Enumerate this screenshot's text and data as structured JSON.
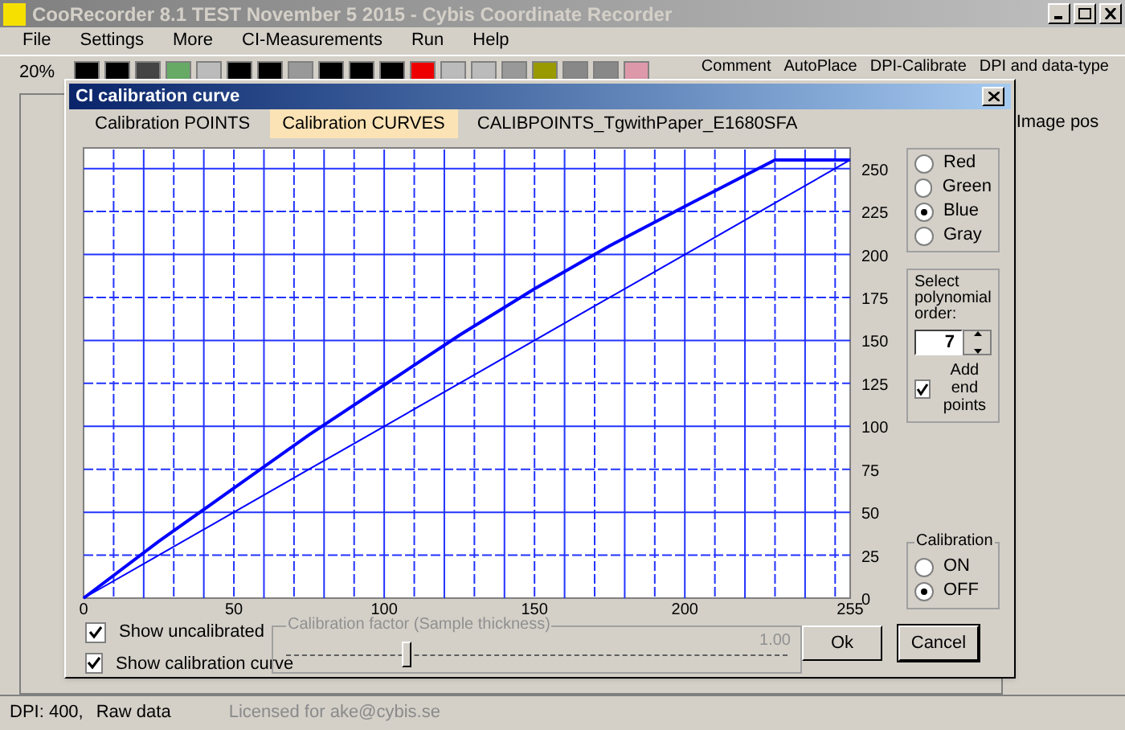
{
  "window": {
    "title": "CooRecorder 8.1 TEST November 5 2015 - Cybis Coordinate Recorder"
  },
  "menu": [
    "File",
    "Settings",
    "More",
    "CI-Measurements",
    "Run",
    "Help"
  ],
  "toolbar": {
    "zoom": "20%",
    "commands": [
      "Comment",
      "AutoPlace",
      "DPI-Calibrate",
      "DPI and data-type"
    ],
    "side_label": "Image pos"
  },
  "dialog": {
    "title": "CI calibration curve",
    "tabs": [
      {
        "label": "Calibration POINTS",
        "selected": false
      },
      {
        "label": "Calibration CURVES",
        "selected": true
      }
    ],
    "file_label": "CALIBPOINTS_TgwithPaper_E1680SFA",
    "chart_data": {
      "type": "line",
      "grid": true,
      "x": [
        0,
        25,
        50,
        75,
        100,
        125,
        150,
        175,
        200,
        230,
        255
      ],
      "series": [
        {
          "color": "#0000ff",
          "values": [
            0,
            33,
            64,
            95,
            124,
            153,
            180,
            205,
            228,
            255,
            255
          ]
        },
        {
          "color": "#0000ff",
          "values": [
            0,
            25,
            50,
            75,
            100,
            125,
            150,
            175,
            200,
            230,
            255
          ]
        }
      ],
      "xlim": [
        0,
        255
      ],
      "ylim": [
        0,
        262
      ],
      "xticks": [
        0,
        50,
        100,
        150,
        200,
        255
      ],
      "yticks": [
        0,
        25,
        50,
        75,
        100,
        125,
        150,
        175,
        200,
        225,
        250
      ]
    },
    "channels": [
      {
        "label": "Red",
        "selected": false
      },
      {
        "label": "Green",
        "selected": false
      },
      {
        "label": "Blue",
        "selected": true
      },
      {
        "label": "Gray",
        "selected": false
      }
    ],
    "polynomial": {
      "label": "Select polynomial order:",
      "value": "7"
    },
    "add_end_points": {
      "label": "Add end points",
      "checked": true
    },
    "calibration": {
      "title": "Calibration",
      "options": [
        {
          "label": "ON",
          "selected": false
        },
        {
          "label": "OFF",
          "selected": true
        }
      ]
    },
    "checkboxes": [
      {
        "label": "Show uncalibrated",
        "checked": true
      },
      {
        "label": "Show calibration curve",
        "checked": true
      }
    ],
    "slider": {
      "title": "Calibration factor (Sample thickness)",
      "reading": "1.00",
      "level": 0.24
    },
    "buttons": [
      "Ok",
      "Cancel"
    ]
  },
  "status_bar": [
    "DPI: 400,",
    "Raw data",
    "Licensed for ake@cybis.se"
  ]
}
